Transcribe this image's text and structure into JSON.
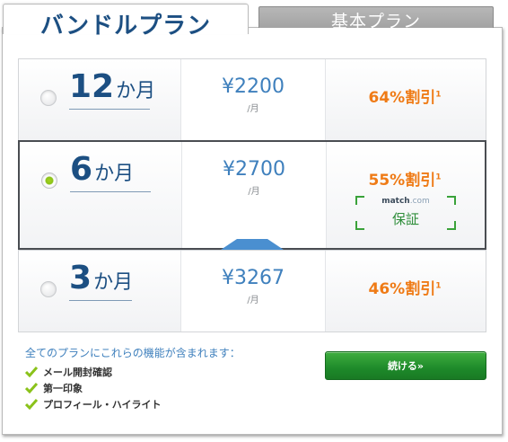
{
  "tabs": {
    "active_label": "バンドルプラン",
    "inactive_label": "基本プラン"
  },
  "plans": [
    {
      "months": "12",
      "months_unit": "か月",
      "price": "¥2200",
      "price_unit": "/月",
      "discount": "64%割引",
      "footnote": "1",
      "selected": false
    },
    {
      "months": "6",
      "months_unit": "か月",
      "price": "¥2700",
      "price_unit": "/月",
      "discount": "55%割引",
      "footnote": "1",
      "selected": true,
      "guarantee_brand": "match",
      "guarantee_brand_suffix": ".com",
      "guarantee_label": "保証"
    },
    {
      "months": "3",
      "months_unit": "か月",
      "price": "¥3267",
      "price_unit": "/月",
      "discount": "46%割引",
      "footnote": "1",
      "selected": false
    }
  ],
  "features": {
    "title": "全てのプランにこれらの機能が含まれます：",
    "items": [
      "メール開封確認",
      "第一印象",
      "プロフィール・ハイライト"
    ]
  },
  "continue_button": {
    "label": "続ける»"
  },
  "colors": {
    "brand_blue": "#1c4f82",
    "price_blue": "#3f80bd",
    "discount_orange": "#ef7b16",
    "accent_green": "#8ac21a",
    "button_green": "#1e8a2a"
  }
}
